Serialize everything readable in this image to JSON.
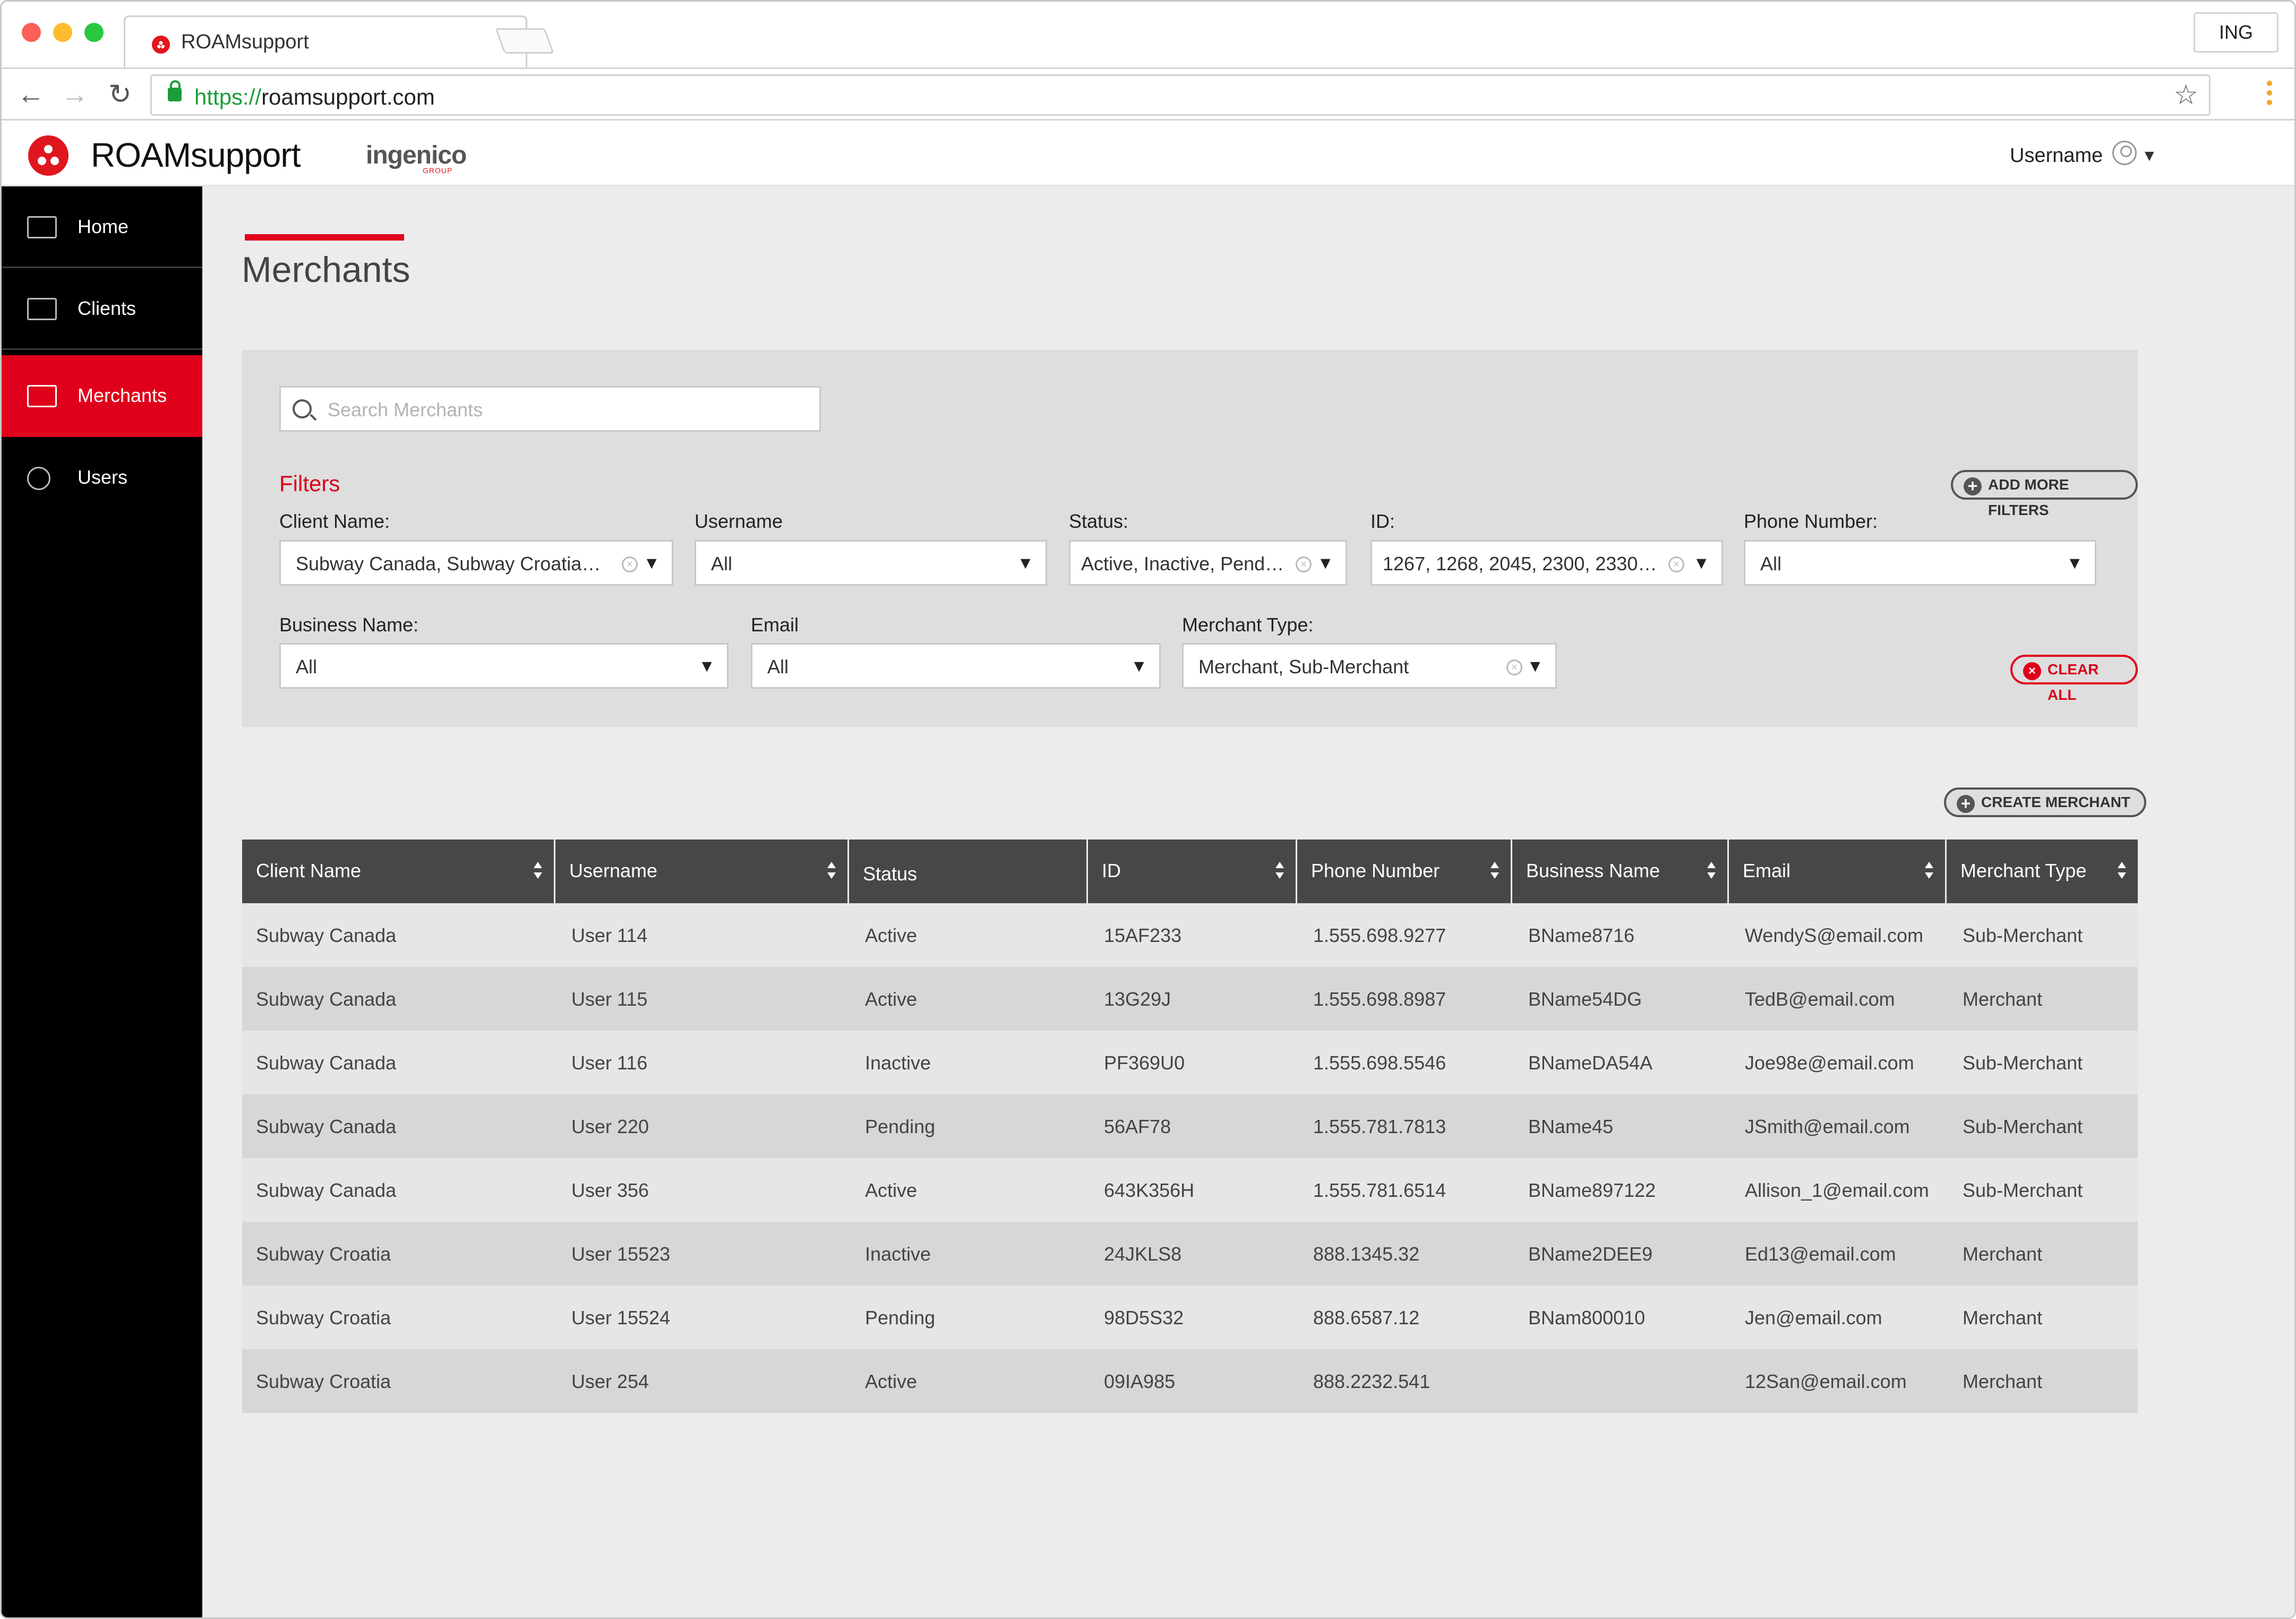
{
  "browser": {
    "tab_title": "ROAMsupport",
    "profile": "ING",
    "url_scheme": "https://",
    "url_host": "roamsupport.com"
  },
  "header": {
    "app_name": "ROAMsupport",
    "partner_logo": "ingenico",
    "partner_logo_sub": "GROUP",
    "username": "Username"
  },
  "sidebar": {
    "items": [
      {
        "label": "Home",
        "icon": "home-icon"
      },
      {
        "label": "Clients",
        "icon": "id-card-icon"
      },
      {
        "label": "Merchants",
        "icon": "storefront-icon"
      },
      {
        "label": "Users",
        "icon": "user-icon"
      }
    ],
    "active": "Merchants"
  },
  "page": {
    "title": "Merchants",
    "search_placeholder": "Search Merchants",
    "filters_title": "Filters",
    "add_filters_label": "ADD MORE FILTERS",
    "clear_all_label": "CLEAR ALL",
    "create_label": "CREATE MERCHANT"
  },
  "filters": {
    "client_name": {
      "label": "Client Name:",
      "value": "Subway Canada, Subway Croatia…"
    },
    "username": {
      "label": "Username",
      "value": "All"
    },
    "status": {
      "label": "Status:",
      "value": "Active, Inactive, Pend…"
    },
    "id": {
      "label": "ID:",
      "value": "1267, 1268, 2045, 2300, 2330…"
    },
    "phone": {
      "label": "Phone Number:",
      "value": "All"
    },
    "business_name": {
      "label": "Business Name:",
      "value": "All"
    },
    "email": {
      "label": "Email",
      "value": "All"
    },
    "merchant_type": {
      "label": "Merchant Type:",
      "value": "Merchant, Sub-Merchant"
    }
  },
  "table": {
    "columns": [
      "Client Name",
      "Username",
      "Status",
      "ID",
      "Phone Number",
      "Business Name",
      "Email",
      "Merchant Type"
    ],
    "rows": [
      [
        "Subway Canada",
        "User 114",
        "Active",
        "15AF233",
        "1.555.698.9277",
        "BName8716",
        "WendyS@email.com",
        "Sub-Merchant"
      ],
      [
        "Subway Canada",
        "User 115",
        "Active",
        "13G29J",
        "1.555.698.8987",
        "BName54DG",
        "TedB@email.com",
        "Merchant"
      ],
      [
        "Subway Canada",
        "User 116",
        "Inactive",
        "PF369U0",
        "1.555.698.5546",
        "BNameDA54A",
        "Joe98e@email.com",
        "Sub-Merchant"
      ],
      [
        "Subway Canada",
        "User 220",
        "Pending",
        "56AF78",
        "1.555.781.7813",
        "BName45",
        "JSmith@email.com",
        "Sub-Merchant"
      ],
      [
        "Subway Canada",
        "User 356",
        "Active",
        "643K356H",
        "1.555.781.6514",
        "BName897122",
        "Allison_1@email.com",
        "Sub-Merchant"
      ],
      [
        "Subway Croatia",
        "User 15523",
        "Inactive",
        "24JKLS8",
        "888.1345.32",
        "BName2DEE9",
        "Ed13@email.com",
        "Merchant"
      ],
      [
        "Subway Croatia",
        "User 15524",
        "Pending",
        "98D5S32",
        "888.6587.12",
        "BNam800010",
        "Jen@email.com",
        "Merchant"
      ],
      [
        "Subway Croatia",
        "User 254",
        "Active",
        "09IA985",
        "888.2232.541",
        "",
        "12San@email.com",
        "Merchant"
      ]
    ]
  },
  "colors": {
    "accent": "#e0001b",
    "sidebar_bg": "#000000",
    "table_header_bg": "#474747",
    "panel_bg": "#dedede"
  }
}
